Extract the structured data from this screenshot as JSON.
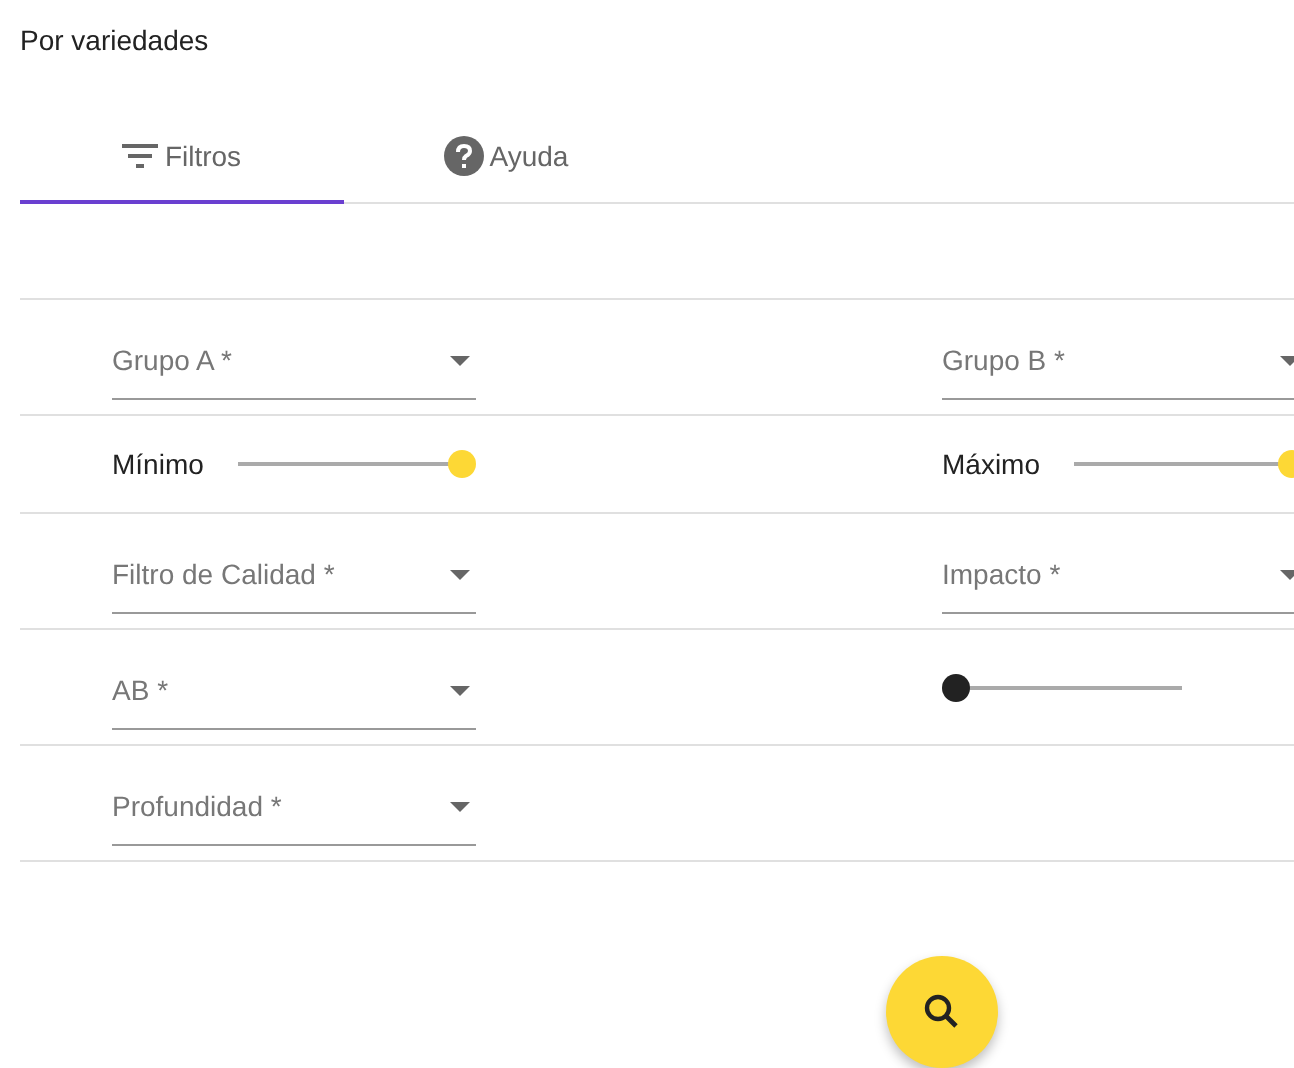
{
  "title": "Por variedades",
  "tabs": [
    {
      "label": "Filtros",
      "selected": true
    },
    {
      "label": "Ayuda",
      "selected": false
    }
  ],
  "rows": [
    {
      "left": {
        "kind": "select",
        "label": "Grupo A *"
      },
      "right": {
        "kind": "select",
        "label": "Grupo B *"
      }
    },
    {
      "left": {
        "kind": "slider",
        "label": "Mínimo",
        "level": 1
      },
      "right": {
        "kind": "slider",
        "label": "Máximo",
        "level": 1
      }
    },
    {
      "left": {
        "kind": "select",
        "label": "Filtro de Calidad *"
      },
      "right": {
        "kind": "select",
        "label": "Impacto *"
      }
    },
    {
      "left": {
        "kind": "select",
        "label": "AB *"
      },
      "right": {
        "kind": "slider",
        "level": 0
      }
    },
    {
      "left": {
        "kind": "select",
        "label": "Profundidad *"
      }
    }
  ]
}
